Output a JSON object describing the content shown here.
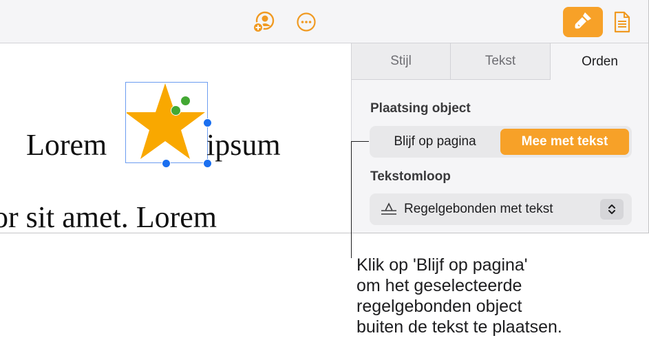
{
  "toolbar": {
    "collaborate_icon": "person-add-icon",
    "more_icon": "ellipsis-icon",
    "format_icon": "paintbrush-icon",
    "document_icon": "document-icon",
    "accent_color": "#f7a128"
  },
  "document": {
    "word_before": "Lorem",
    "word_after": "ipsum",
    "second_line": "or sit amet. Lorem",
    "inline_object": "star-shape",
    "star_color": "#f9a800"
  },
  "inspector": {
    "tabs": [
      {
        "label": "Stijl"
      },
      {
        "label": "Tekst"
      },
      {
        "label": "Orden",
        "selected": true
      }
    ],
    "object_placement": {
      "title": "Plaatsing object",
      "options": [
        "Blijf op pagina",
        "Mee met tekst"
      ],
      "selected": "Mee met tekst"
    },
    "text_wrap": {
      "title": "Tekstomloop",
      "value": "Regelgebonden met tekst",
      "icon": "inline-wrap-icon"
    }
  },
  "callout": {
    "lines": [
      "Klik op 'Blijf op pagina'",
      "om het geselecteerde",
      "regelgebonden object",
      "buiten de tekst te plaatsen."
    ]
  }
}
